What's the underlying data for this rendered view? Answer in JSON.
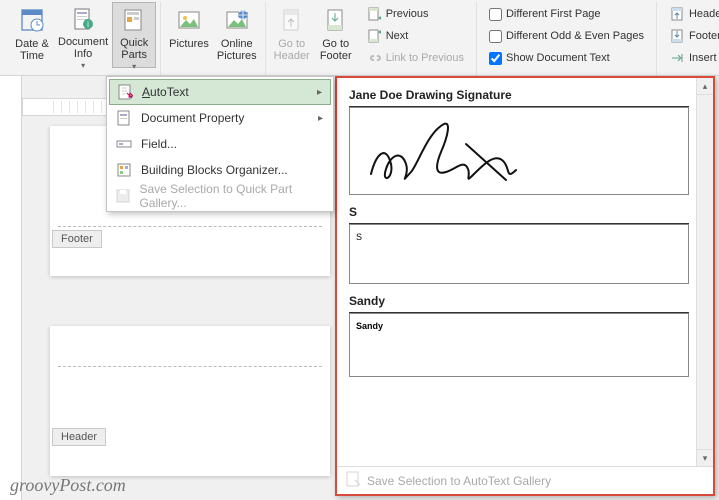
{
  "ribbon": {
    "datetime": "Date &\nTime",
    "docinfo": "Document\nInfo",
    "quickparts": "Quick\nParts",
    "pictures": "Pictures",
    "onlinepics": "Online\nPictures",
    "gotoheader": "Go to\nHeader",
    "gotofooter": "Go to\nFooter",
    "previous": "Previous",
    "next": "Next",
    "linkprev": "Link to Previous",
    "diff_first": "Different First Page",
    "diff_oddeven": "Different Odd & Even Pages",
    "show_doctext": "Show Document Text",
    "header_from_top": "Header from Top:",
    "footer_from_bottom": "Footer from Bottom",
    "insert_align": "Insert Alignment Tab"
  },
  "quickparts_menu": {
    "autotext_prefix": "A",
    "autotext_rest": "utoText",
    "docprop": "Document Property",
    "field": "Field...",
    "bborg": "Building Blocks Organizer...",
    "savesel": "Save Selection to Quick Part Gallery..."
  },
  "autotext_gallery": {
    "entries": {
      "e1": {
        "title": "Jane Doe Drawing Signature"
      },
      "e2": {
        "title": "S",
        "content": "S"
      },
      "e3": {
        "title": "Sandy",
        "content": "Sandy"
      }
    },
    "footer": "Save Selection to AutoText Gallery"
  },
  "page": {
    "footer_label": "Footer",
    "header_label": "Header"
  },
  "watermark": "groovyPost.com"
}
